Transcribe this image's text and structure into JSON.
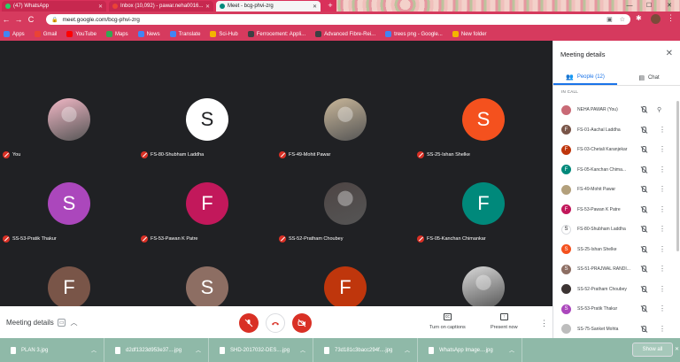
{
  "browser": {
    "tabs": [
      {
        "title": "(47) WhatsApp",
        "color": "#25d366"
      },
      {
        "title": "Inbox (10,092) - pawar.neha0016...",
        "color": "#ea4335"
      },
      {
        "title": "Meet - bcg-phvi-zrg",
        "color": "#00897b"
      }
    ],
    "new_tab": "+",
    "url": "meet.google.com/bcg-phvi-zrg",
    "nav": {
      "back": "←",
      "forward": "→",
      "reload": "C"
    },
    "window_controls": {
      "minimize": "—",
      "maximize": "☐",
      "close": "✕"
    }
  },
  "bookmarks": [
    {
      "label": "Apps",
      "color": "#4285f4"
    },
    {
      "label": "Gmail",
      "color": "#ea4335"
    },
    {
      "label": "YouTube",
      "color": "#ff0000"
    },
    {
      "label": "Maps",
      "color": "#34a853"
    },
    {
      "label": "News",
      "color": "#4285f4"
    },
    {
      "label": "Translate",
      "color": "#4285f4"
    },
    {
      "label": "Sci-Hub",
      "color": "#f4b400"
    },
    {
      "label": "Ferrocement: Appli...",
      "color": "#3c4043"
    },
    {
      "label": "Advanced Fibre-Rei...",
      "color": "#3c4043"
    },
    {
      "label": "trees png - Google...",
      "color": "#3c4043"
    },
    {
      "label": "New folder",
      "color": "#f4b400"
    }
  ],
  "grid": [
    {
      "label": "You",
      "initial": "",
      "bg": "#f2b8c6",
      "photo": true
    },
    {
      "label": "FS-80-Shubham Laddha",
      "initial": "S",
      "bg": "#ffffff",
      "photo": false,
      "fg": "#202124"
    },
    {
      "label": "FS-49-Mohit Pawar",
      "initial": "",
      "bg": "#c9b79a",
      "photo": true
    },
    {
      "label": "SS-25-Ishan Shelke",
      "initial": "S",
      "bg": "#f4511e",
      "photo": false
    },
    {
      "label": "SS-53-Pratik Thakur",
      "initial": "S",
      "bg": "#ab47bc",
      "photo": false
    },
    {
      "label": "FS-53-Pawan K Patre",
      "initial": "F",
      "bg": "#c2185b",
      "photo": false
    },
    {
      "label": "SS-52-Pratham Choubey",
      "initial": "",
      "bg": "#4e4544",
      "photo": true
    },
    {
      "label": "FS-05-Kanchan Chimankar",
      "initial": "F",
      "bg": "#00897b",
      "photo": false
    },
    {
      "label": "FS-01-Aachal Laddha",
      "initial": "F",
      "bg": "#795548",
      "photo": false
    },
    {
      "label": "SS-51-PRAJWAL RANDIWE",
      "initial": "S",
      "bg": "#8d6e63",
      "photo": false
    },
    {
      "label": "FS-03-Chetali Karanjekar",
      "initial": "F",
      "bg": "#bf360c",
      "photo": false
    },
    {
      "label": "SS-75-Sanket Mohta",
      "initial": "",
      "bg": "#d9d9d9",
      "photo": true
    }
  ],
  "bottom_bar": {
    "meeting_details": "Meeting details",
    "captions": "Turn on captions",
    "present": "Present now"
  },
  "panel": {
    "title": "Meeting details",
    "close": "✕",
    "tab_people": "People (12)",
    "tab_chat": "Chat",
    "in_call": "IN CALL",
    "people": [
      {
        "name": "NEHA PAWAR (You)",
        "initial": "",
        "bg": "#c96a76"
      },
      {
        "name": "FS-01-Aachal Laddha",
        "initial": "F",
        "bg": "#795548"
      },
      {
        "name": "FS-03-Chetali Karanjekar",
        "initial": "F",
        "bg": "#bf360c"
      },
      {
        "name": "FS-05-Kanchan Chima...",
        "initial": "F",
        "bg": "#00897b"
      },
      {
        "name": "FS-49-Mohit Pawar",
        "initial": "",
        "bg": "#b3a07c"
      },
      {
        "name": "FS-53-Pawan K Patre",
        "initial": "F",
        "bg": "#c2185b"
      },
      {
        "name": "FS-80-Shubham Laddha",
        "initial": "S",
        "bg": "#ffffff"
      },
      {
        "name": "SS-25-Ishan Shelke",
        "initial": "S",
        "bg": "#f4511e"
      },
      {
        "name": "SS-51-PRAJWAL RANDI...",
        "initial": "S",
        "bg": "#8d6e63"
      },
      {
        "name": "SS-52-Pratham Choubey",
        "initial": "",
        "bg": "#3c3433"
      },
      {
        "name": "SS-53-Pratik Thakur",
        "initial": "S",
        "bg": "#ab47bc"
      },
      {
        "name": "SS-75-Sanket Mohta",
        "initial": "",
        "bg": "#bdbdbd"
      }
    ]
  },
  "downloads": [
    "PLAN 3.jpg",
    "d2df1323d953e37....jpg",
    "SHD-2017032-DES....jpg",
    "73d181c3bacc294f....jpg",
    "WhatsApp Image....jpg"
  ],
  "show_all": "Show all",
  "colors": {
    "mic_off": "#d93025",
    "accent": "#1a73e8"
  }
}
